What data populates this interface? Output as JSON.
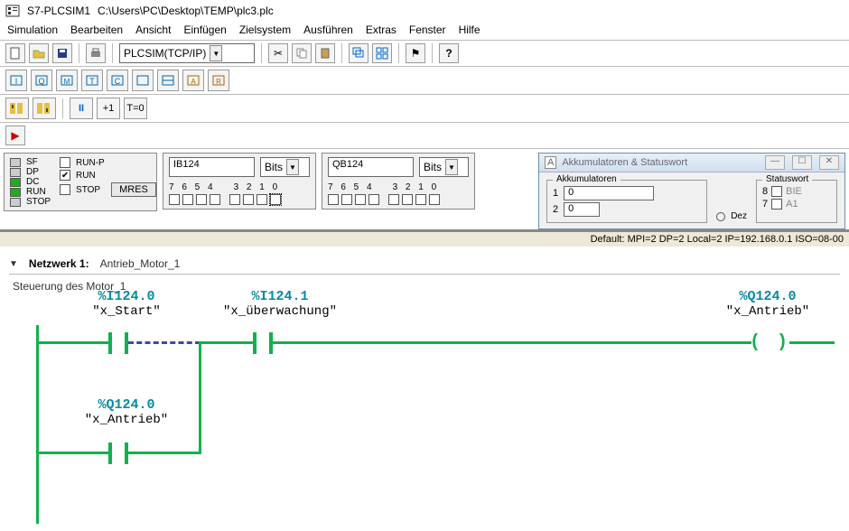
{
  "title": {
    "app": "S7-PLCSIM1",
    "path": "C:\\Users\\PC\\Desktop\\TEMP\\plc3.plc"
  },
  "menu": [
    "Simulation",
    "Bearbeiten",
    "Ansicht",
    "Einfügen",
    "Zielsystem",
    "Ausführen",
    "Extras",
    "Fenster",
    "Hilfe"
  ],
  "toolbar1": {
    "combo": "PLCSIM(TCP/IP)"
  },
  "toolbar3": {
    "pause": "II",
    "step": "+1",
    "t0": "T=0"
  },
  "cpu": {
    "leds": [
      "SF",
      "DP",
      "DC",
      "RUN",
      "STOP"
    ],
    "runp_checked": false,
    "runp_label": "RUN-P",
    "run_checked": true,
    "run_label": "RUN",
    "stop_checked": false,
    "stop_label": "STOP",
    "mres": "MRES"
  },
  "ib": {
    "addr": "IB124",
    "fmt": "Bits",
    "bits_hi": "7 6 5 4",
    "bits_lo": "3 2 1 0"
  },
  "qb": {
    "addr": "QB124",
    "fmt": "Bits",
    "bits_hi": "7 6 5 4",
    "bits_lo": "3 2 1 0"
  },
  "accu": {
    "title": "Akkumulatoren & Statuswort",
    "grp1": "Akkumulatoren",
    "grp2": "Statuswort",
    "row1": "1",
    "val1": "0",
    "row2": "2",
    "val2": "0",
    "dez": "Dez",
    "s8": "8",
    "s8l": "BIE",
    "s7": "7",
    "s7l": "A1"
  },
  "status": "Default: MPI=2 DP=2 Local=2 IP=192.168.0.1 ISO=08-00",
  "network": {
    "label": "Netzwerk 1:",
    "name": "Antrieb_Motor_1",
    "comment": "Steuerung des Motor_1"
  },
  "tags": {
    "i0": {
      "addr": "%I124.0",
      "sym": "\"x_Start\""
    },
    "i1": {
      "addr": "%I124.1",
      "sym": "\"x_überwachung\""
    },
    "q0_top": {
      "addr": "%Q124.0",
      "sym": "\"x_Antrieb\""
    },
    "q0_bot": {
      "addr": "%Q124.0",
      "sym": "\"x_Antrieb\""
    }
  }
}
